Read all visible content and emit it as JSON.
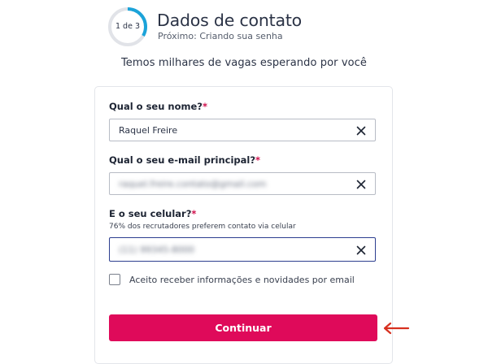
{
  "header": {
    "step_indicator": "1 de 3",
    "step_progress": 0.333,
    "title": "Dados de contato",
    "next_step": "Próximo: Criando sua senha"
  },
  "tagline": "Temos milhares de vagas esperando por você",
  "form": {
    "name": {
      "label": "Qual o seu nome?",
      "value": "Raquel Freire"
    },
    "email": {
      "label": "Qual o seu e-mail principal?",
      "value": "raquel.freire.contato@gmail.com"
    },
    "phone": {
      "label": "E o seu celular?",
      "hint": "76% dos recrutadores preferem contato via celular",
      "value": "(11) 99345-8000"
    },
    "required_mark": "*",
    "consent": {
      "label": "Aceito receber informações e novidades por email",
      "checked": false
    },
    "submit_label": "Continuar"
  },
  "colors": {
    "accent": "#df0a5a",
    "progress": "#1ba3d9",
    "required": "#d0104c",
    "annotation_arrow": "#d7301f"
  },
  "icons": {
    "clear": "close-icon",
    "annotation": "arrow-left-icon"
  }
}
